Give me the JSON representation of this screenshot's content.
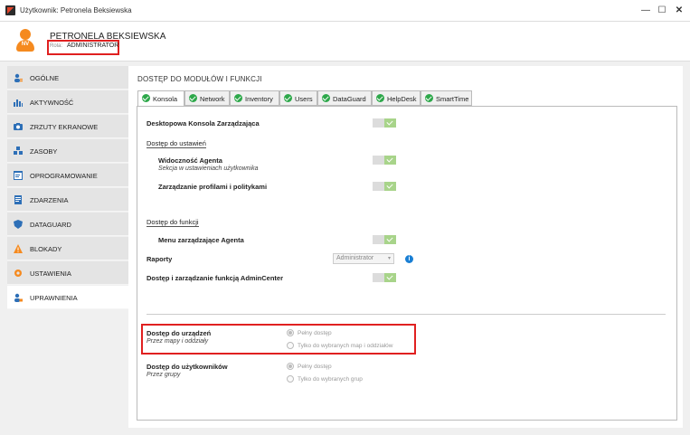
{
  "window": {
    "title": "Użytkownik: Petronela Beksiewska"
  },
  "user": {
    "initials": "NV",
    "name": "PETRONELA BEKSIEWSKA",
    "role_label": "Rola:",
    "role_value": "ADMINISTRATOR"
  },
  "sidebar": {
    "items": [
      {
        "label": "OGÓLNE",
        "icon": "user-icon"
      },
      {
        "label": "AKTYWNOŚĆ",
        "icon": "activity-icon"
      },
      {
        "label": "ZRZUTY EKRANOWE",
        "icon": "camera-icon"
      },
      {
        "label": "ZASOBY",
        "icon": "resources-icon"
      },
      {
        "label": "OPROGRAMOWANIE",
        "icon": "software-icon"
      },
      {
        "label": "ZDARZENIA",
        "icon": "events-icon"
      },
      {
        "label": "DATAGUARD",
        "icon": "shield-icon"
      },
      {
        "label": "BLOKADY",
        "icon": "warning-icon"
      },
      {
        "label": "USTAWIENIA",
        "icon": "gear-icon"
      },
      {
        "label": "UPRAWNIENIA",
        "icon": "user-lock-icon"
      }
    ],
    "active_index": 9
  },
  "content": {
    "section_title": "DOSTĘP DO MODUŁÓW I FUNKCJI",
    "tabs": [
      {
        "label": "Konsola"
      },
      {
        "label": "Network"
      },
      {
        "label": "Inventory"
      },
      {
        "label": "Users"
      },
      {
        "label": "DataGuard"
      },
      {
        "label": "HelpDesk"
      },
      {
        "label": "SmartTime"
      }
    ],
    "active_tab": 0,
    "desktop_console": "Desktopowa Konsola Zarządzająca",
    "settings_access": "Dostęp do ustawień",
    "agent_visibility": "Widoczność Agenta",
    "agent_visibility_sub": "Sekcja w ustawieniach użytkownika",
    "profiles_management": "Zarządzanie profilami i politykami",
    "functions_access": "Dostęp do funkcji",
    "agent_menu": "Menu zarządzające Agenta",
    "reports": "Raporty",
    "reports_value": "Administrator",
    "admincenter": "Dostęp i zarządzanie funkcją AdminCenter",
    "devices_access": "Dostęp do urządzeń",
    "devices_access_sub": "Przez mapy i oddziały",
    "devices_full": "Pełny dostęp",
    "devices_selected": "Tylko do wybranych map i oddziałów",
    "users_access": "Dostęp do użytkowników",
    "users_access_sub": "Przez grupy",
    "users_full": "Pełny dostęp",
    "users_selected": "Tylko do wybranych grup"
  },
  "colors": {
    "accent_green": "#2da84a",
    "toggle_on": "#a8d48a",
    "highlight_red": "#e02020",
    "avatar_orange": "#f58a1f",
    "info_blue": "#1a7fd4"
  }
}
